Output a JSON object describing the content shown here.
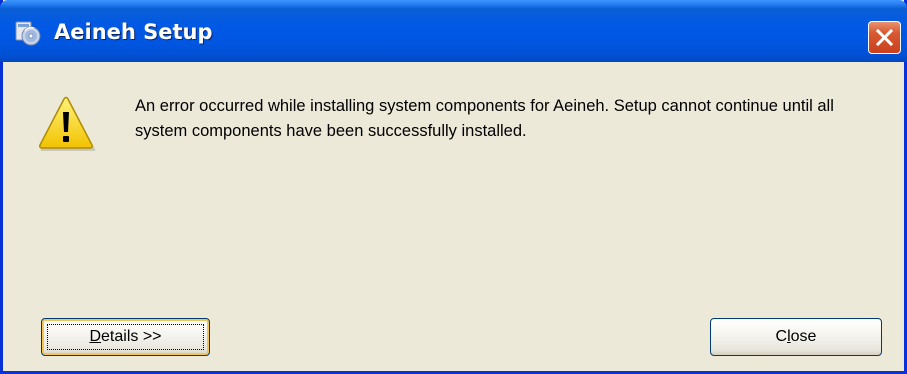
{
  "window": {
    "title": "Aeineh Setup",
    "title_icon": "setup-disc-icon",
    "close_icon": "close-x-icon"
  },
  "message": {
    "icon": "warning-icon",
    "text": "An error occurred while installing system components for Aeineh. Setup cannot continue until all system components have been successfully installed."
  },
  "buttons": {
    "details": {
      "mnemonic": "D",
      "rest": "etails >>"
    },
    "close": {
      "first": "C",
      "mnemonic": "l",
      "rest": "ose"
    }
  },
  "colors": {
    "titlebar": "#0058e6",
    "dialog_bg": "#ece9d8",
    "close_button": "#d85a32",
    "focus_ring": "#f3c456"
  }
}
